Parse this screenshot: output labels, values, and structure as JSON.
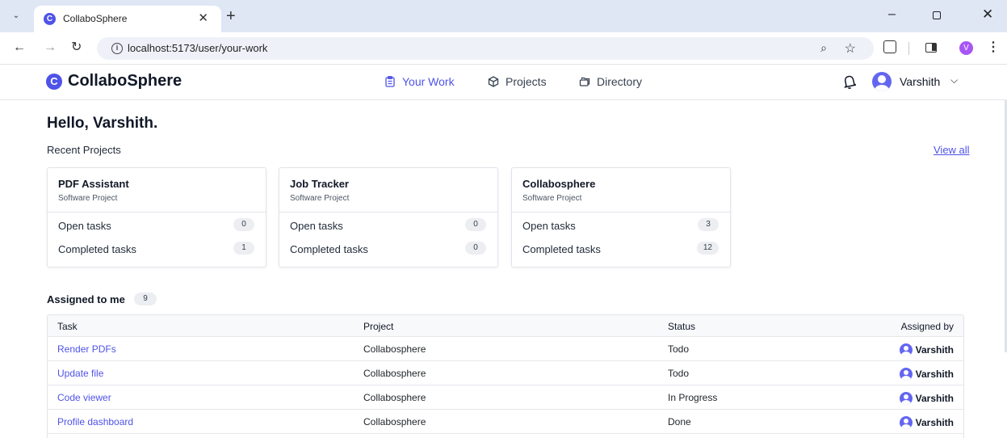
{
  "browser": {
    "tab_title": "CollaboSphere",
    "favicon_letter": "C",
    "url": "localhost:5173/user/your-work",
    "profile_initial": "V"
  },
  "app": {
    "logo_letter": "C",
    "logo_text": "CollaboSphere",
    "nav": [
      {
        "label": "Your Work",
        "icon": "clipboard-icon",
        "active": true
      },
      {
        "label": "Projects",
        "icon": "cube-icon",
        "active": false
      },
      {
        "label": "Directory",
        "icon": "folders-icon",
        "active": false
      }
    ],
    "user_name": "Varshith"
  },
  "main": {
    "greeting": "Hello, Varshith.",
    "recent_title": "Recent Projects",
    "view_all": "View all",
    "projects": [
      {
        "name": "PDF Assistant",
        "type": "Software Project",
        "open_label": "Open tasks",
        "open": "0",
        "done_label": "Completed tasks",
        "done": "1"
      },
      {
        "name": "Job Tracker",
        "type": "Software Project",
        "open_label": "Open tasks",
        "open": "0",
        "done_label": "Completed tasks",
        "done": "0"
      },
      {
        "name": "Collabosphere",
        "type": "Software Project",
        "open_label": "Open tasks",
        "open": "3",
        "done_label": "Completed tasks",
        "done": "12"
      }
    ],
    "assigned_title": "Assigned to me",
    "assigned_count": "9",
    "table": {
      "headers": [
        "Task",
        "Project",
        "Status",
        "Assigned by"
      ],
      "rows": [
        {
          "task": "Render PDFs",
          "project": "Collabosphere",
          "status": "Todo",
          "by": "Varshith"
        },
        {
          "task": "Update file",
          "project": "Collabosphere",
          "status": "Todo",
          "by": "Varshith"
        },
        {
          "task": "Code viewer",
          "project": "Collabosphere",
          "status": "In Progress",
          "by": "Varshith"
        },
        {
          "task": "Profile dashboard",
          "project": "Collabosphere",
          "status": "Done",
          "by": "Varshith"
        }
      ]
    }
  },
  "colors": {
    "accent": "#4f53e8",
    "avatar": "#6366f1",
    "profile_badge": "#a855f7"
  }
}
